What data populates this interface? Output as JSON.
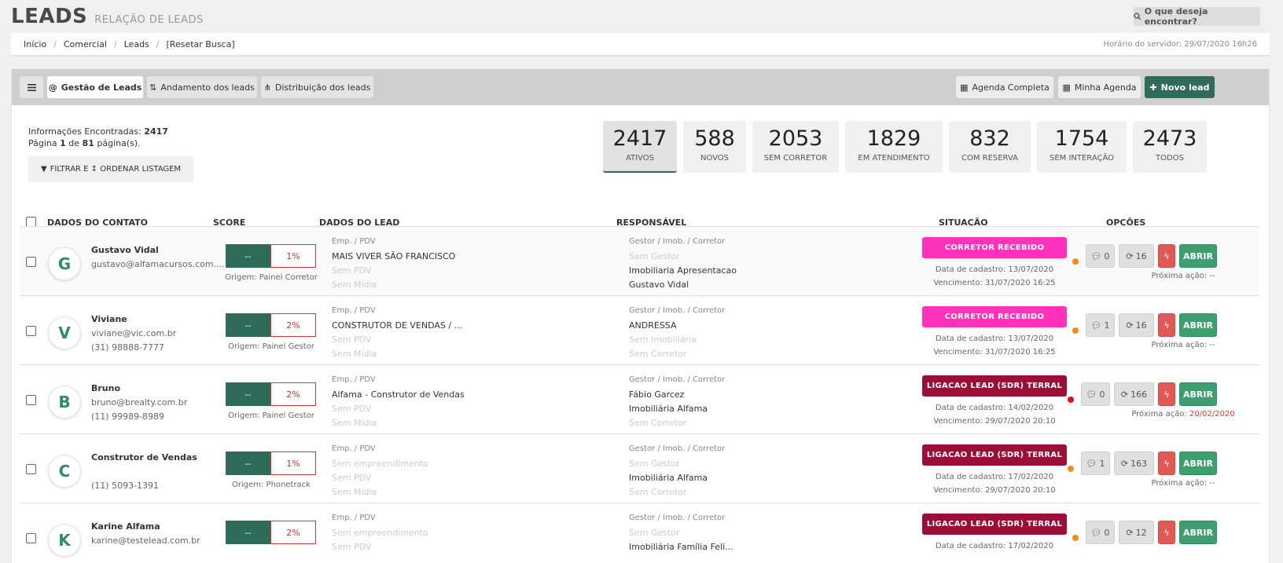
{
  "header": {
    "title": "LEADS",
    "subtitle": "RELAÇÃO DE LEADS",
    "search_label": "O que deseja encontrar?"
  },
  "breadcrumb": {
    "items": [
      "Início",
      "Comercial",
      "Leads",
      "[Resetar Busca]"
    ],
    "server_time": "Horário do servidor: 29/07/2020 16h26"
  },
  "toolbar": {
    "tabs": [
      "Gestão de Leads",
      "Andamento dos leads",
      "Distribuição dos leads"
    ],
    "agenda_completa": "Agenda Completa",
    "minha_agenda": "Minha Agenda",
    "novo_lead": "Novo lead"
  },
  "summary": {
    "info_label": "Informações Encontradas:",
    "info_count": "2417",
    "page_label": "Página",
    "page_current": "1",
    "page_of": "de",
    "page_total": "81",
    "page_suffix": "página(s).",
    "filter_label": "FILTRAR E ↕ ORDENAR LISTAGEM"
  },
  "stats": [
    {
      "value": "2417",
      "label": "Ativos"
    },
    {
      "value": "588",
      "label": "Novos"
    },
    {
      "value": "2053",
      "label": "Sem Corretor"
    },
    {
      "value": "1829",
      "label": "Em Atendimento"
    },
    {
      "value": "832",
      "label": "Com Reserva"
    },
    {
      "value": "1754",
      "label": "Sem Interação"
    },
    {
      "value": "2473",
      "label": "Todos"
    }
  ],
  "columns": [
    "DADOS DO CONTATO",
    "SCORE",
    "DADOS DO LEAD",
    "RESPONSÁVEL",
    "SITUAÇÃO",
    "OPÇÕES"
  ],
  "colors": {
    "accent": "#2f6b58",
    "pink": "#ff33bb",
    "maroon": "#9b0f37",
    "dot_orange": "#f08c1a",
    "dot_red": "#e01010"
  },
  "rows": [
    {
      "avatar": "G",
      "name": "Gustavo Vidal",
      "email": "gustavo@alfamacursos.com....",
      "phone": "",
      "score_left": "--",
      "score_right": "1%",
      "origin": "Origem: Painel Corretor",
      "lead_label": "Emp. / PDV",
      "lead_1": "MAIS VIVER SÃO FRANCISCO",
      "lead_2": "Sem PDV",
      "lead_3": "Sem Mídia",
      "resp_label": "Gestor / Imob. / Corretor",
      "resp_1": "Sem Gestor",
      "resp_2": "Imobiliaria Apresentacao",
      "resp_3": "Gustavo Vidal",
      "situation": "CORRETOR RECEBIDO",
      "cadastro": "Data de cadastro: 13/07/2020",
      "vencimento": "Vencimento: 31/07/2020 16:25",
      "dot": "orange",
      "comments": "0",
      "refresh": "16",
      "action": "ABRIR",
      "next_label": "Próxima ação:",
      "next_value": "--"
    },
    {
      "avatar": "V",
      "name": "Viviane",
      "email": "viviane@vic.com.br",
      "phone": "(31) 98888-7777",
      "score_left": "--",
      "score_right": "2%",
      "origin": "Origem: Painel Gestor",
      "lead_label": "Emp. / PDV",
      "lead_1": "CONSTRUTOR DE VENDAS / ...",
      "lead_2": "Sem PDV",
      "lead_3": "Sem Mídia",
      "resp_label": "Gestor / Imob. / Corretor",
      "resp_1": "ANDRESSA",
      "resp_2": "Sem Imobiliária",
      "resp_3": "Sem Corretor",
      "situation": "CORRETOR RECEBIDO",
      "cadastro": "Data de cadastro: 13/07/2020",
      "vencimento": "Vencimento: 31/07/2020 16:25",
      "dot": "orange",
      "comments": "1",
      "refresh": "16",
      "action": "ABRIR",
      "next_label": "Próxima ação:",
      "next_value": "--"
    },
    {
      "avatar": "B",
      "name": "Bruno",
      "email": "bruno@brealty.com.br",
      "phone": "(11) 99989-8989",
      "score_left": "--",
      "score_right": "2%",
      "origin": "Origem: Painel Gestor",
      "lead_label": "Emp. / PDV",
      "lead_1": "Alfama - Construtor de Vendas",
      "lead_2": "Sem PDV",
      "lead_3": "Sem Mídia",
      "resp_label": "Gestor / Imob. / Corretor",
      "resp_1": "Fábio Garcez",
      "resp_2": "Imobiliária Alfama",
      "resp_3": "Sem Corretor",
      "situation": "LIGACAO LEAD (SDR) TERRAL",
      "cadastro": "Data de cadastro: 14/02/2020",
      "vencimento": "Vencimento: 29/07/2020 20:10",
      "dot": "red",
      "comments": "0",
      "refresh": "166",
      "action": "ABRIR",
      "next_label": "Próxima ação:",
      "next_value": "20/02/2020"
    },
    {
      "avatar": "C",
      "name": "Construtor de Vendas",
      "email": "",
      "phone": "(11) 5093-1391",
      "score_left": "--",
      "score_right": "1%",
      "origin": "Origem: Phonetrack",
      "lead_label": "Emp. / PDV",
      "lead_1": "Sem empreendimento",
      "lead_2": "Sem PDV",
      "lead_3": "Sem Mídia",
      "resp_label": "Gestor / Imob. / Corretor",
      "resp_1": "Sem Gestor",
      "resp_2": "Imobiliária Alfama",
      "resp_3": "Sem Corretor",
      "situation": "LIGACAO LEAD (SDR) TERRAL",
      "cadastro": "Data de cadastro: 17/02/2020",
      "vencimento": "Vencimento: 29/07/2020 20:10",
      "dot": "orange",
      "comments": "1",
      "refresh": "163",
      "action": "ABRIR",
      "next_label": "Próxima ação:",
      "next_value": "--"
    },
    {
      "avatar": "K",
      "name": "Karine Alfama",
      "email": "karine@testelead.com.br",
      "phone": "",
      "score_left": "--",
      "score_right": "2%",
      "origin": "",
      "lead_label": "Emp. / PDV",
      "lead_1": "Sem empreendimento",
      "lead_2": "Sem PDV",
      "lead_3": "",
      "resp_label": "Gestor / Imob. / Corretor",
      "resp_1": "Sem Gestor",
      "resp_2": "Imobiliária Família Feli...",
      "resp_3": "",
      "situation": "LIGACAO LEAD (SDR) TERRAL",
      "cadastro": "Data de cadastro: 17/02/2020",
      "vencimento": "",
      "dot": "orange",
      "comments": "0",
      "refresh": "12",
      "action": "ABRIR",
      "next_label": "",
      "next_value": ""
    }
  ]
}
